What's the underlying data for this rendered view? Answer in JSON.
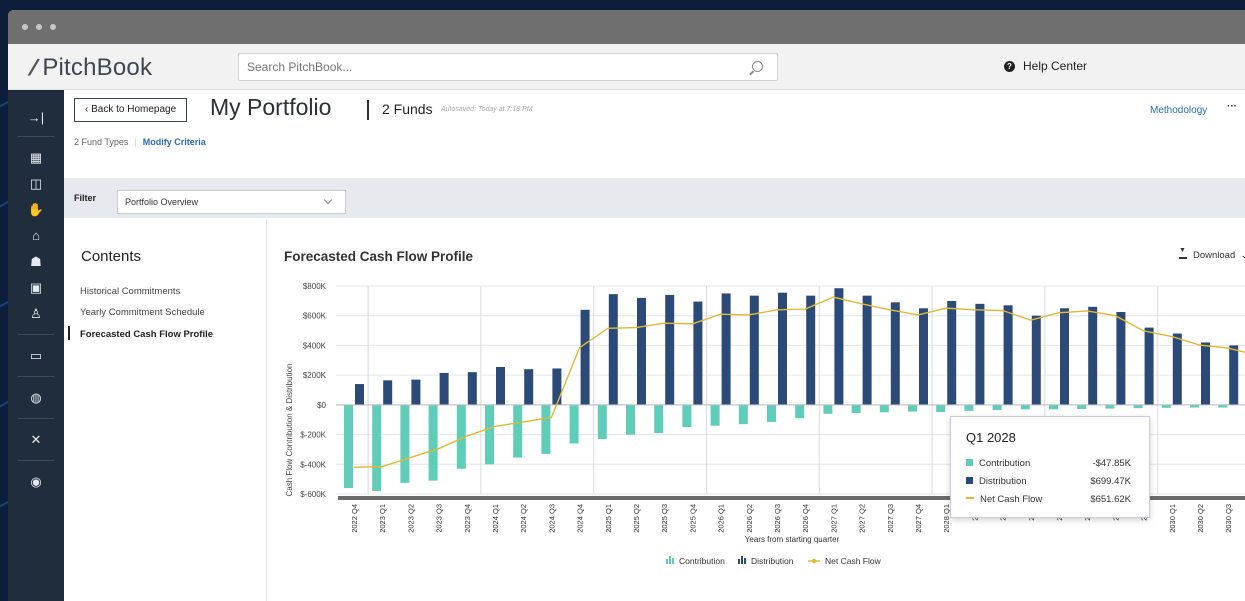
{
  "app": {
    "brand": "PitchBook",
    "search_placeholder": "Search PitchBook...",
    "help": "Help Center"
  },
  "sidebar_icons": [
    "collapse-icon",
    "building-icon",
    "chart-icon",
    "handshake-icon",
    "bank-icon",
    "people-icon",
    "money-icon",
    "investor-icon",
    "book-icon",
    "globe-icon",
    "tools-icon",
    "user-icon"
  ],
  "header": {
    "back": "‹  Back to Homepage",
    "title": "My Portfolio",
    "funds": "2 Funds",
    "autosave": "Autosaved: Today at 7:18 PM",
    "methodology": "Methodology",
    "more": "···",
    "fund_types": "2 Fund Types",
    "modify": "Modify Criteria"
  },
  "filter": {
    "label": "Filter",
    "value": "Portfolio Overview"
  },
  "contents": {
    "title": "Contents",
    "items": [
      "Historical Commitments",
      "Yearly Commitment Schedule",
      "Forecasted Cash Flow Profile"
    ]
  },
  "chart_title": "Forecasted Cash Flow Profile",
  "download": "Download",
  "tooltip": {
    "title": "Q1 2028",
    "rows": [
      {
        "label": "Contribution",
        "value": "-$47.85K"
      },
      {
        "label": "Distribution",
        "value": "$699.47K"
      },
      {
        "label": "Net Cash Flow",
        "value": "$651.62K"
      }
    ]
  },
  "colors": {
    "contribution": "#5fcdb8",
    "distribution": "#2b4a78",
    "net": "#e1b934",
    "sidebar": "#1f2d3d",
    "link": "#2a6db5"
  },
  "chart_data": {
    "type": "bar",
    "xlabel": "Years from starting quarter",
    "ylabel": "Cash Flow Contribution & Distribution",
    "ylim": [
      -600,
      800
    ],
    "yticks": [
      800,
      600,
      400,
      200,
      0,
      -200,
      -400,
      -600
    ],
    "ytick_labels": [
      "$800K",
      "$600K",
      "$400K",
      "$200K",
      "$0",
      "$-200K",
      "$-400K",
      "$-600K"
    ],
    "categories": [
      "2022 Q4",
      "2023 Q1",
      "2023 Q2",
      "2023 Q3",
      "2023 Q4",
      "2024 Q1",
      "2024 Q2",
      "2024 Q3",
      "2024 Q4",
      "2025 Q1",
      "2025 Q2",
      "2025 Q3",
      "2025 Q4",
      "2026 Q1",
      "2026 Q2",
      "2026 Q3",
      "2026 Q4",
      "2027 Q1",
      "2027 Q2",
      "2027 Q3",
      "2027 Q4",
      "2028 Q1",
      "2028",
      "2028",
      "2028",
      "2029",
      "2029",
      "2029",
      "2029",
      "2030 Q1",
      "2030 Q2",
      "2030 Q3",
      ""
    ],
    "series": [
      {
        "name": "Contribution",
        "values": [
          -560,
          -580,
          -525,
          -510,
          -430,
          -400,
          -355,
          -330,
          -260,
          -230,
          -200,
          -190,
          -150,
          -140,
          -130,
          -115,
          -90,
          -60,
          -55,
          -50,
          -45,
          -48,
          -40,
          -35,
          -30,
          -30,
          -28,
          -25,
          -22,
          -20,
          -18,
          -18,
          -15
        ]
      },
      {
        "name": "Distribution",
        "values": [
          140,
          165,
          170,
          215,
          220,
          255,
          240,
          245,
          640,
          745,
          720,
          740,
          695,
          750,
          735,
          755,
          735,
          785,
          735,
          690,
          650,
          699,
          680,
          670,
          600,
          650,
          660,
          625,
          520,
          480,
          420,
          400,
          350
        ]
      },
      {
        "name": "Net Cash Flow",
        "values": [
          -420,
          -415,
          -355,
          -295,
          -210,
          -145,
          -115,
          -85,
          385,
          515,
          520,
          550,
          545,
          610,
          605,
          640,
          645,
          725,
          680,
          640,
          605,
          651,
          640,
          635,
          570,
          620,
          632,
          600,
          498,
          460,
          402,
          382,
          335
        ]
      }
    ],
    "legend": "bottom-center",
    "grid": true
  }
}
